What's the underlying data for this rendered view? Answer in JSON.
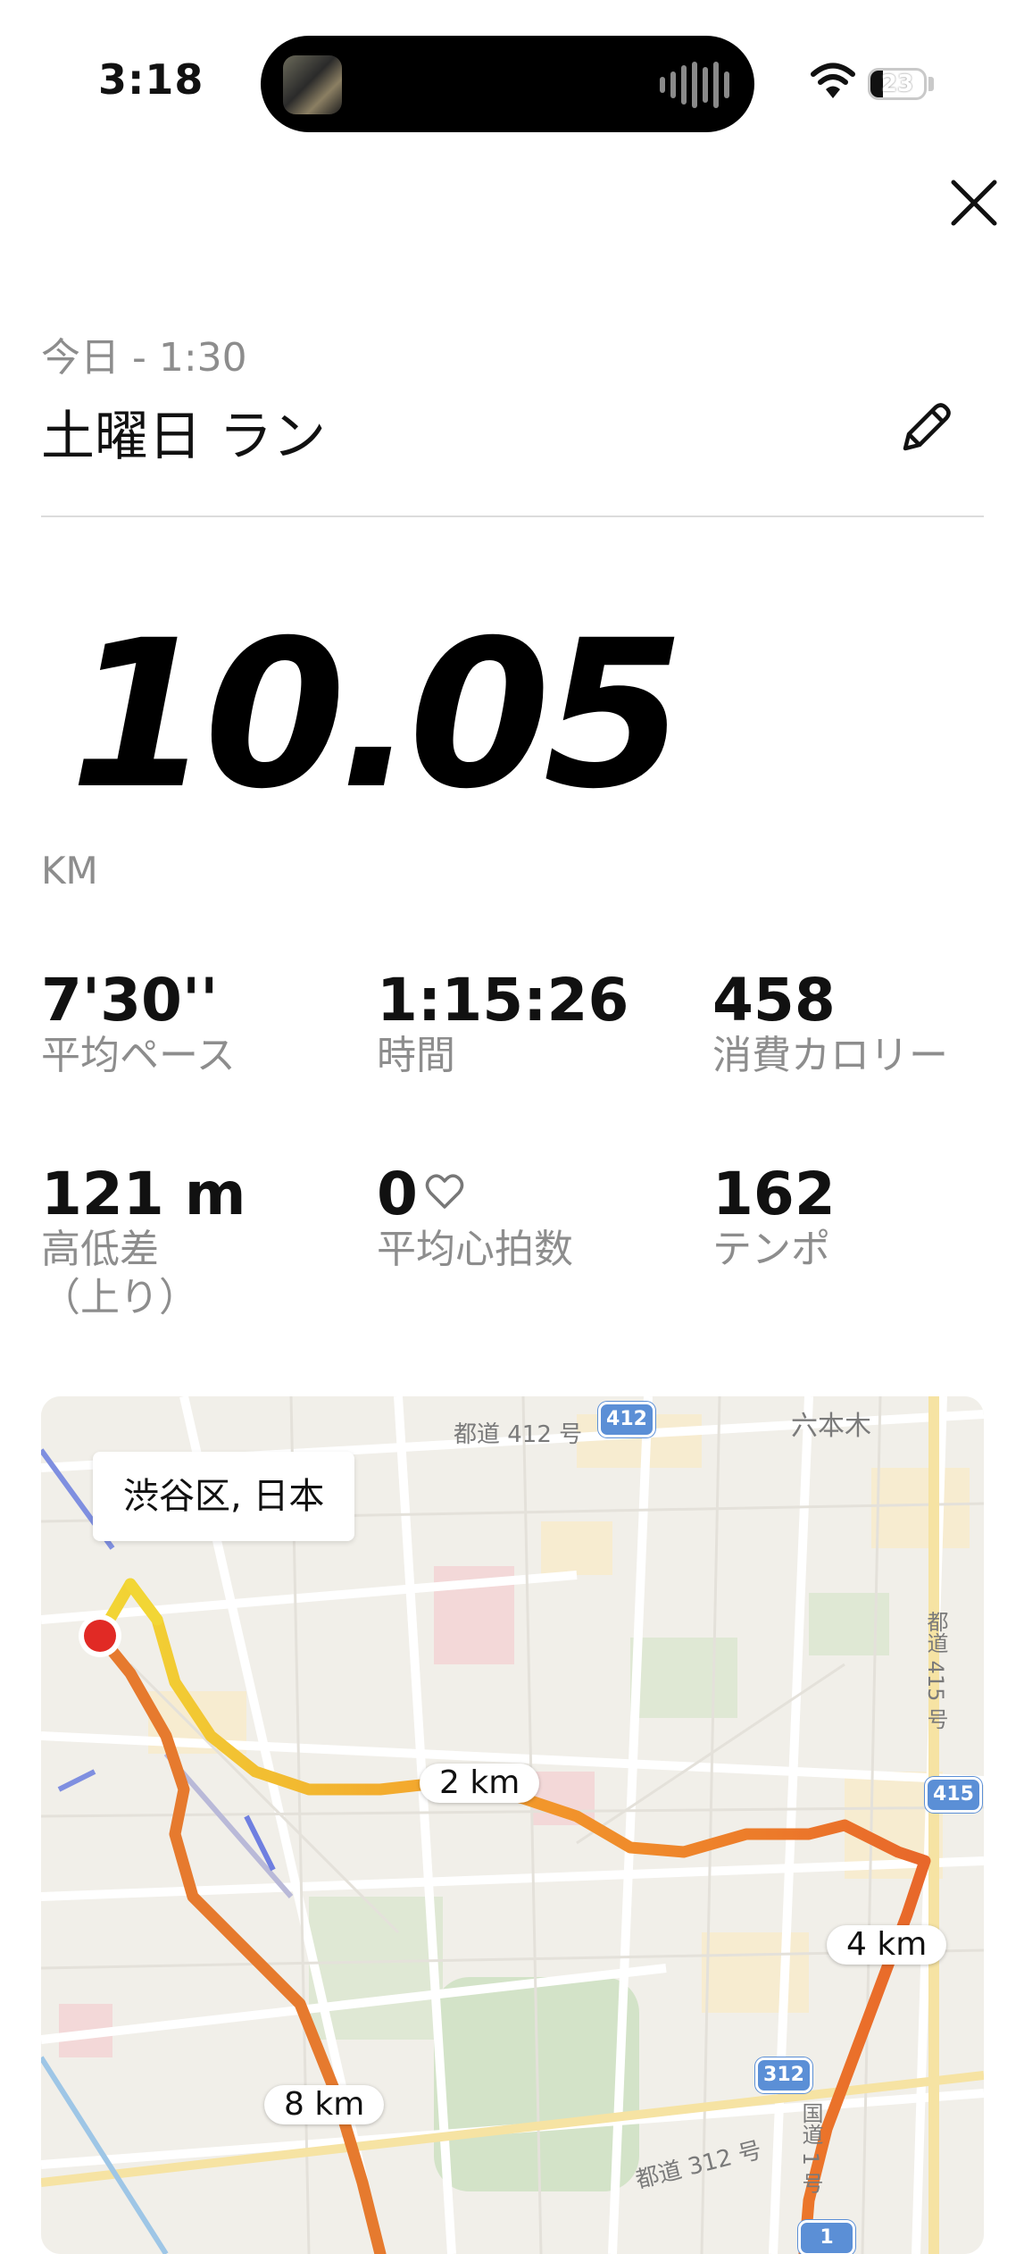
{
  "status_bar": {
    "time": "3:18",
    "battery_level": "23"
  },
  "header": {
    "date_time": "今日 - 1:30",
    "title": "土曜日 ラン"
  },
  "run": {
    "distance": "10.05",
    "distance_unit": "KM"
  },
  "stats": [
    {
      "value": "7'30''",
      "label": "平均ペース"
    },
    {
      "value": "1:15:26",
      "label": "時間"
    },
    {
      "value": "458",
      "label": "消費カロリー"
    },
    {
      "value": "121 m",
      "label": "高低差\n（上り）"
    },
    {
      "value": "0",
      "label": "平均心拍数"
    },
    {
      "value": "162",
      "label": "テンポ"
    }
  ],
  "map": {
    "location_label": "渋谷区, 日本",
    "km_markers": [
      "2 km",
      "4 km",
      "8 km"
    ],
    "place_names": [
      "六本木",
      "都道 412 号",
      "都道 415 号",
      "都道 312 号",
      "国道 1 号"
    ],
    "route_shields": [
      "412",
      "415",
      "312",
      "1"
    ],
    "route_colors": [
      "#f2d635",
      "#f39a2b",
      "#e8672a",
      "#d94b2c"
    ]
  }
}
